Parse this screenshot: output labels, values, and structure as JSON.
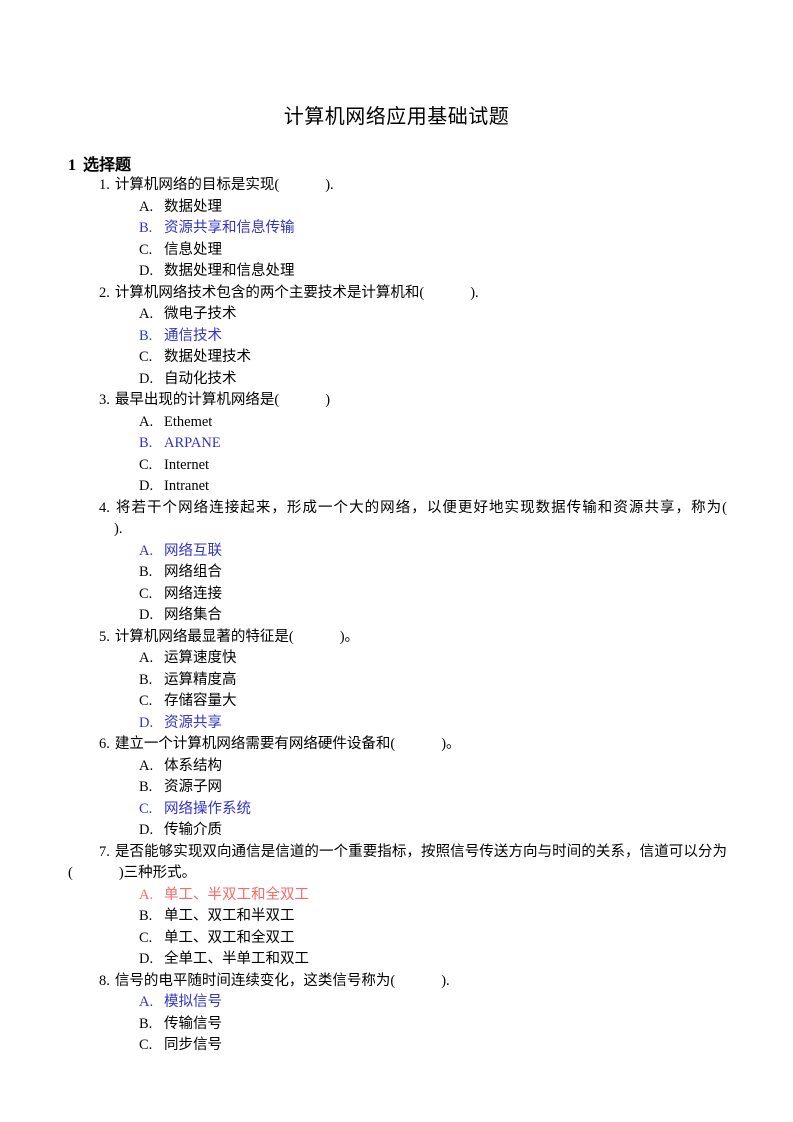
{
  "document": {
    "title": "计算机网络应用基础试题",
    "section": {
      "number": "1",
      "label": "选择题"
    }
  },
  "colors": {
    "text": "#000000",
    "answer_blue": "#3333CC",
    "answer_red": "#FA6A6A",
    "background": "#FFFFFF"
  },
  "questions": [
    {
      "number": "1.",
      "stem": "计算机网络的目标是实现(",
      "stem_tail": ").",
      "options": [
        {
          "letter": "A.",
          "text": "数据处理",
          "color": "black"
        },
        {
          "letter": "B.",
          "text": "资源共享和信息传输",
          "color": "blue"
        },
        {
          "letter": "C.",
          "text": "信息处理",
          "color": "black"
        },
        {
          "letter": "D.",
          "text": "数据处理和信息处理",
          "color": "black"
        }
      ]
    },
    {
      "number": "2.",
      "stem": "计算机网络技术包含的两个主要技术是计算机和(",
      "stem_tail": ").",
      "options": [
        {
          "letter": "A.",
          "text": "微电子技术",
          "color": "black"
        },
        {
          "letter": "B.",
          "text": "通信技术",
          "color": "blue"
        },
        {
          "letter": "C.",
          "text": "数据处理技术",
          "color": "black"
        },
        {
          "letter": "D.",
          "text": "自动化技术",
          "color": "black"
        }
      ]
    },
    {
      "number": "3.",
      "stem": "最早出现的计算机网络是(",
      "stem_tail": ")",
      "options": [
        {
          "letter": "A.",
          "text": "Ethemet",
          "color": "black"
        },
        {
          "letter": "B.",
          "text": "ARPANE",
          "color": "blue"
        },
        {
          "letter": "C.",
          "text": "Internet",
          "color": "black"
        },
        {
          "letter": "D.",
          "text": "Intranet",
          "color": "black"
        }
      ]
    },
    {
      "number": "4.",
      "stem": "将若干个网络连接起来，形成一个大的网络，以便更好地实现数据传输和资源共享，称为(",
      "stem_tail": ").",
      "options": [
        {
          "letter": "A.",
          "text": "网络互联",
          "color": "blue"
        },
        {
          "letter": "B.",
          "text": "网络组合",
          "color": "black"
        },
        {
          "letter": "C.",
          "text": "网络连接",
          "color": "black"
        },
        {
          "letter": "D.",
          "text": "网络集合",
          "color": "black"
        }
      ]
    },
    {
      "number": "5.",
      "stem": "计算机网络最显著的特征是(",
      "stem_tail": ")。",
      "options": [
        {
          "letter": "A.",
          "text": "运算速度快",
          "color": "black"
        },
        {
          "letter": "B.",
          "text": "运算精度高",
          "color": "black"
        },
        {
          "letter": "C.",
          "text": "存储容量大",
          "color": "black"
        },
        {
          "letter": "D.",
          "text": "资源共享",
          "color": "blue"
        }
      ]
    },
    {
      "number": "6.",
      "stem": "建立一个计算机网络需要有网络硬件设备和(",
      "stem_tail": ")。",
      "options": [
        {
          "letter": "A.",
          "text": "体系结构",
          "color": "black"
        },
        {
          "letter": "B.",
          "text": "资源子网",
          "color": "black"
        },
        {
          "letter": "C.",
          "text": "网络操作系统",
          "color": "blue"
        },
        {
          "letter": "D.",
          "text": "传输介质",
          "color": "black"
        }
      ]
    },
    {
      "number": "7.",
      "stem": "是否能够实现双向通信是信道的一个重要指标，按照信号传送方向与时间的关系，信道可以分为(",
      "stem_tail": ")三种形式。",
      "options": [
        {
          "letter": "A.",
          "text": "单工、半双工和全双工",
          "color": "red"
        },
        {
          "letter": "B.",
          "text": "单工、双工和半双工",
          "color": "black"
        },
        {
          "letter": "C.",
          "text": "单工、双工和全双工",
          "color": "black"
        },
        {
          "letter": "D.",
          "text": "全单工、半单工和双工",
          "color": "black"
        }
      ]
    },
    {
      "number": "8.",
      "stem": "信号的电平随时间连续变化，这类信号称为(",
      "stem_tail": ").",
      "options": [
        {
          "letter": "A.",
          "text": "模拟信号",
          "color": "blue"
        },
        {
          "letter": "B.",
          "text": "传输信号",
          "color": "black"
        },
        {
          "letter": "C.",
          "text": "同步信号",
          "color": "black"
        }
      ]
    }
  ]
}
